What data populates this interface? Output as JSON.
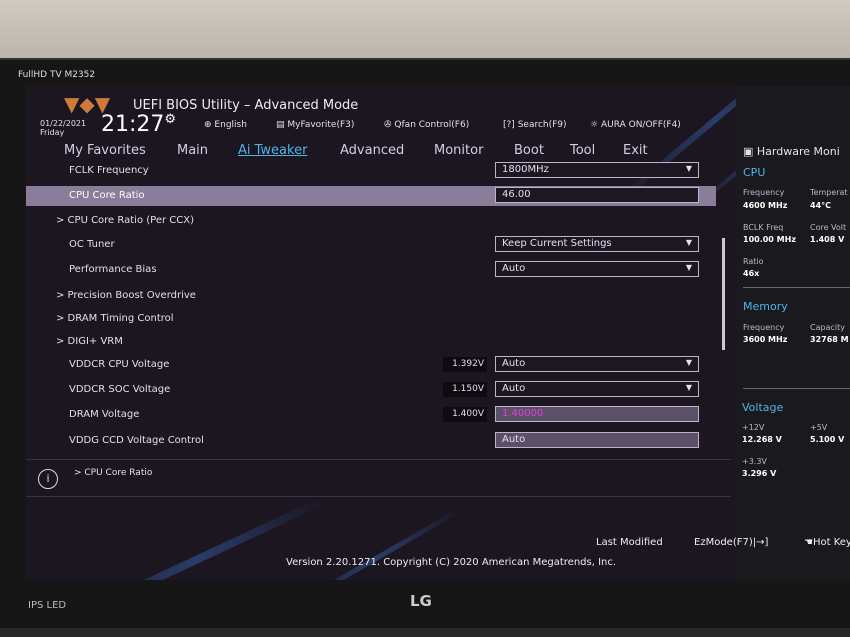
{
  "monitor": {
    "brand": "FullHD TV M2352",
    "panel": "IPS LED",
    "logo": "LG"
  },
  "header": {
    "title": "UEFI BIOS Utility – Advanced Mode",
    "date": "01/22/2021",
    "day": "Friday",
    "time": "21:27",
    "tools": [
      {
        "icon": "globe-icon",
        "label": "English"
      },
      {
        "icon": "favorite-icon",
        "label": "MyFavorite(F3)"
      },
      {
        "icon": "fan-icon",
        "label": "Qfan Control(F6)"
      },
      {
        "icon": "help-icon",
        "label": "Search(F9)"
      },
      {
        "icon": "aura-icon",
        "label": "AURA ON/OFF(F4)"
      }
    ]
  },
  "tabs": [
    "My Favorites",
    "Main",
    "Ai Tweaker",
    "Advanced",
    "Monitor",
    "Boot",
    "Tool",
    "Exit"
  ],
  "active_tab": "Ai Tweaker",
  "settings": [
    {
      "label": "FCLK Frequency",
      "value": "1800MHz",
      "type": "select"
    },
    {
      "label": "CPU Core Ratio",
      "value": "46.00",
      "type": "input",
      "selected": true
    },
    {
      "label": "> CPU Core Ratio (Per CCX)",
      "type": "submenu"
    },
    {
      "label": "OC Tuner",
      "value": "Keep Current Settings",
      "type": "select"
    },
    {
      "label": "Performance Bias",
      "value": "Auto",
      "type": "select"
    },
    {
      "label": "> Precision Boost Overdrive",
      "type": "submenu"
    },
    {
      "label": "> DRAM Timing Control",
      "type": "submenu"
    },
    {
      "label": "> DIGI+ VRM",
      "type": "submenu"
    },
    {
      "label": "VDDCR CPU Voltage",
      "reading": "1.392V",
      "value": "Auto",
      "type": "select"
    },
    {
      "label": "VDDCR SOC Voltage",
      "reading": "1.150V",
      "value": "Auto",
      "type": "select"
    },
    {
      "label": "DRAM Voltage",
      "reading": "1.400V",
      "value": "1.40000",
      "type": "input-readonly"
    },
    {
      "label": "VDDG CCD Voltage Control",
      "value": "Auto",
      "type": "input-readonly"
    }
  ],
  "info_text": "> CPU Core Ratio",
  "hardware_monitor": {
    "title": "Hardware Moni",
    "cpu": {
      "title": "CPU",
      "items": [
        {
          "k": "Frequency",
          "v": "4600 MHz"
        },
        {
          "k": "Temperat",
          "v": "44°C"
        },
        {
          "k": "BCLK Freq",
          "v": "100.00 MHz"
        },
        {
          "k": "Core Volt",
          "v": "1.408 V"
        },
        {
          "k": "Ratio",
          "v": "46x"
        }
      ]
    },
    "memory": {
      "title": "Memory",
      "items": [
        {
          "k": "Frequency",
          "v": "3600 MHz"
        },
        {
          "k": "Capacity",
          "v": "32768 M"
        }
      ]
    },
    "voltage": {
      "title": "Voltage",
      "items": [
        {
          "k": "+12V",
          "v": "12.268 V"
        },
        {
          "k": "+5V",
          "v": "5.100 V"
        },
        {
          "k": "+3.3V",
          "v": "3.296 V"
        }
      ]
    }
  },
  "footer": {
    "last_modified": "Last Modified",
    "ezmode": "EzMode(F7)|→]",
    "hotkeys": "Hot Keys",
    "version": "Version 2.20.1271. Copyright (C) 2020 American Megatrends, Inc."
  },
  "colors": {
    "accent": "#4fb3ea",
    "highlight": "#8a7d99",
    "value_magenta": "#e040e0"
  }
}
